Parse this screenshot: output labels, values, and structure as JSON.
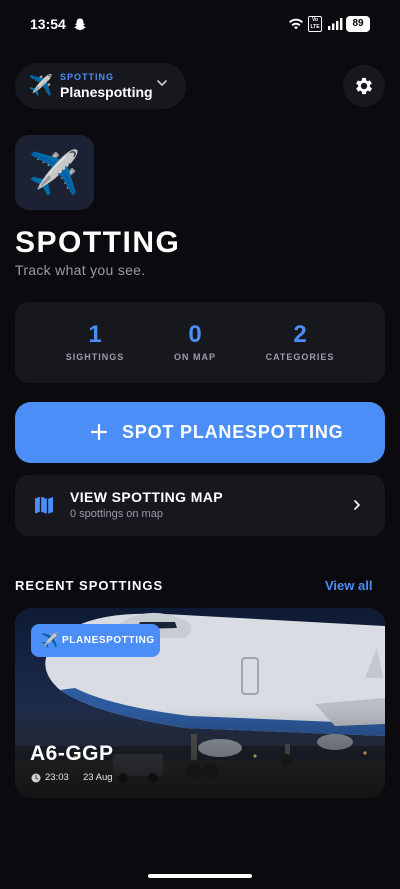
{
  "status_bar": {
    "time": "13:54",
    "volte_label": "Vo LTE",
    "battery": "89",
    "icons": [
      "snapchat-icon",
      "wifi-icon",
      "volte-icon",
      "signal-icon",
      "battery-icon"
    ]
  },
  "header": {
    "mode_kicker": "SPOTTING",
    "mode_title": "Planespotting",
    "mode_icon": "✈️",
    "settings_icon": "gear-icon"
  },
  "hero": {
    "app_icon": "✈️",
    "title": "SPOTTING",
    "subtitle": "Track what you see."
  },
  "stats": [
    {
      "value": "1",
      "label": "SIGHTINGS"
    },
    {
      "value": "0",
      "label": "ON MAP"
    },
    {
      "value": "2",
      "label": "CATEGORIES"
    }
  ],
  "primary_action": {
    "label": "SPOT PLANESPOTTING",
    "icon": "plus-icon"
  },
  "map_row": {
    "title": "VIEW SPOTTING MAP",
    "subtitle": "0 spottings on map",
    "icon": "map-icon"
  },
  "recent": {
    "section_title": "RECENT SPOTTINGS",
    "view_all": "View all",
    "items": [
      {
        "category_icon": "✈️",
        "category": "PLANESPOTTING",
        "registration": "A6-GGP",
        "time": "23:03",
        "date": "23 Aug"
      }
    ]
  },
  "colors": {
    "background": "#0b0b0f",
    "card": "#17181e",
    "accent": "#4b8ef7",
    "muted_text": "#9a9ca6"
  }
}
